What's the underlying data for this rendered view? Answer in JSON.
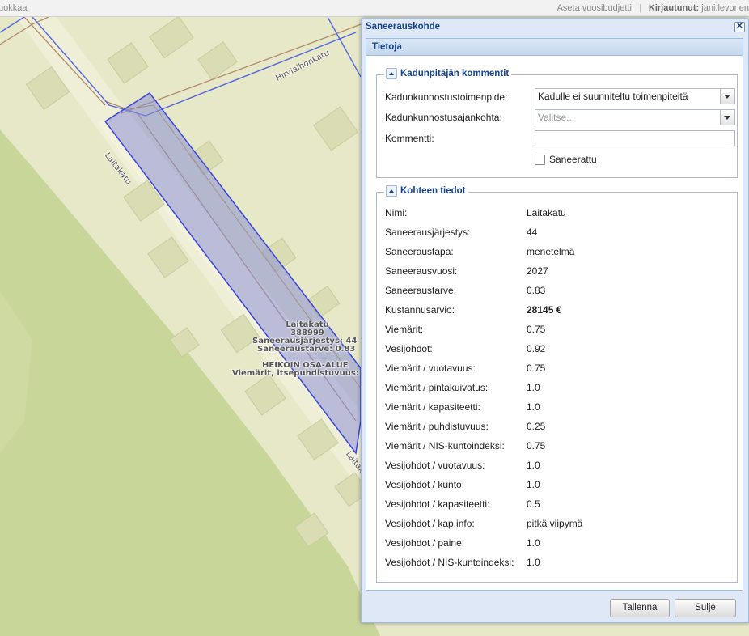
{
  "topbar": {
    "left_text": "uokkaa",
    "budget_link": "Aseta vuosibudjetti",
    "logged_in_label": "Kirjautunut:",
    "user": "jani.levonen"
  },
  "map": {
    "street_label_1": "Hirvialhonkatu",
    "street_label_2": "Laitakatu",
    "street_label_3": "Laitakatu",
    "popup_lines": [
      "Laitakatu",
      "388999",
      "Saneerausjärjestys: 44",
      "Saneeraustarve: 0.83",
      "HEIKOIN OSA-ALUE",
      "Viemärit, itsepuhdistuvuus:"
    ]
  },
  "window": {
    "title": "Saneerauskohde",
    "panel_title": "Tietoja",
    "comments": {
      "legend": "Kadunpitäjän kommentit",
      "measure_label": "Kadunkunnostustoimenpide:",
      "measure_value": "Kadulle ei suunniteltu toimenpiteitä",
      "timing_label": "Kadunkunnostusajankohta:",
      "timing_placeholder": "Valitse...",
      "comment_label": "Kommentti:",
      "comment_value": "",
      "renovated_label": "Saneerattu"
    },
    "details": {
      "legend": "Kohteen tiedot",
      "rows": [
        {
          "k": "Nimi:",
          "v": "Laitakatu"
        },
        {
          "k": "Saneerausjärjestys:",
          "v": "44"
        },
        {
          "k": "Saneeraustapa:",
          "v": "menetelmä"
        },
        {
          "k": "Saneerausvuosi:",
          "v": "2027"
        },
        {
          "k": "Saneeraustarve:",
          "v": "0.83"
        },
        {
          "k": "Kustannusarvio:",
          "v": "28145 €"
        },
        {
          "k": "Viemärit:",
          "v": "0.75"
        },
        {
          "k": "Vesijohdot:",
          "v": "0.92"
        },
        {
          "k": "Viemärit / vuotavuus:",
          "v": "0.75"
        },
        {
          "k": "Viemärit / pintakuivatus:",
          "v": "1.0"
        },
        {
          "k": "Viemärit / kapasiteetti:",
          "v": "1.0"
        },
        {
          "k": "Viemärit / puhdistuvuus:",
          "v": "0.25"
        },
        {
          "k": "Viemärit / NIS-kuntoindeksi:",
          "v": "0.75"
        },
        {
          "k": "Vesijohdot / vuotavuus:",
          "v": "1.0"
        },
        {
          "k": "Vesijohdot / kunto:",
          "v": "1.0"
        },
        {
          "k": "Vesijohdot / kapasiteetti:",
          "v": "0.5"
        },
        {
          "k": "Vesijohdot / kap.info:",
          "v": "pitkä viipymä"
        },
        {
          "k": "Vesijohdot / paine:",
          "v": "1.0"
        },
        {
          "k": "Vesijohdot / NIS-kuntoindeksi:",
          "v": "1.0"
        }
      ]
    },
    "buttons": {
      "save": "Tallenna",
      "close": "Sulje"
    }
  }
}
